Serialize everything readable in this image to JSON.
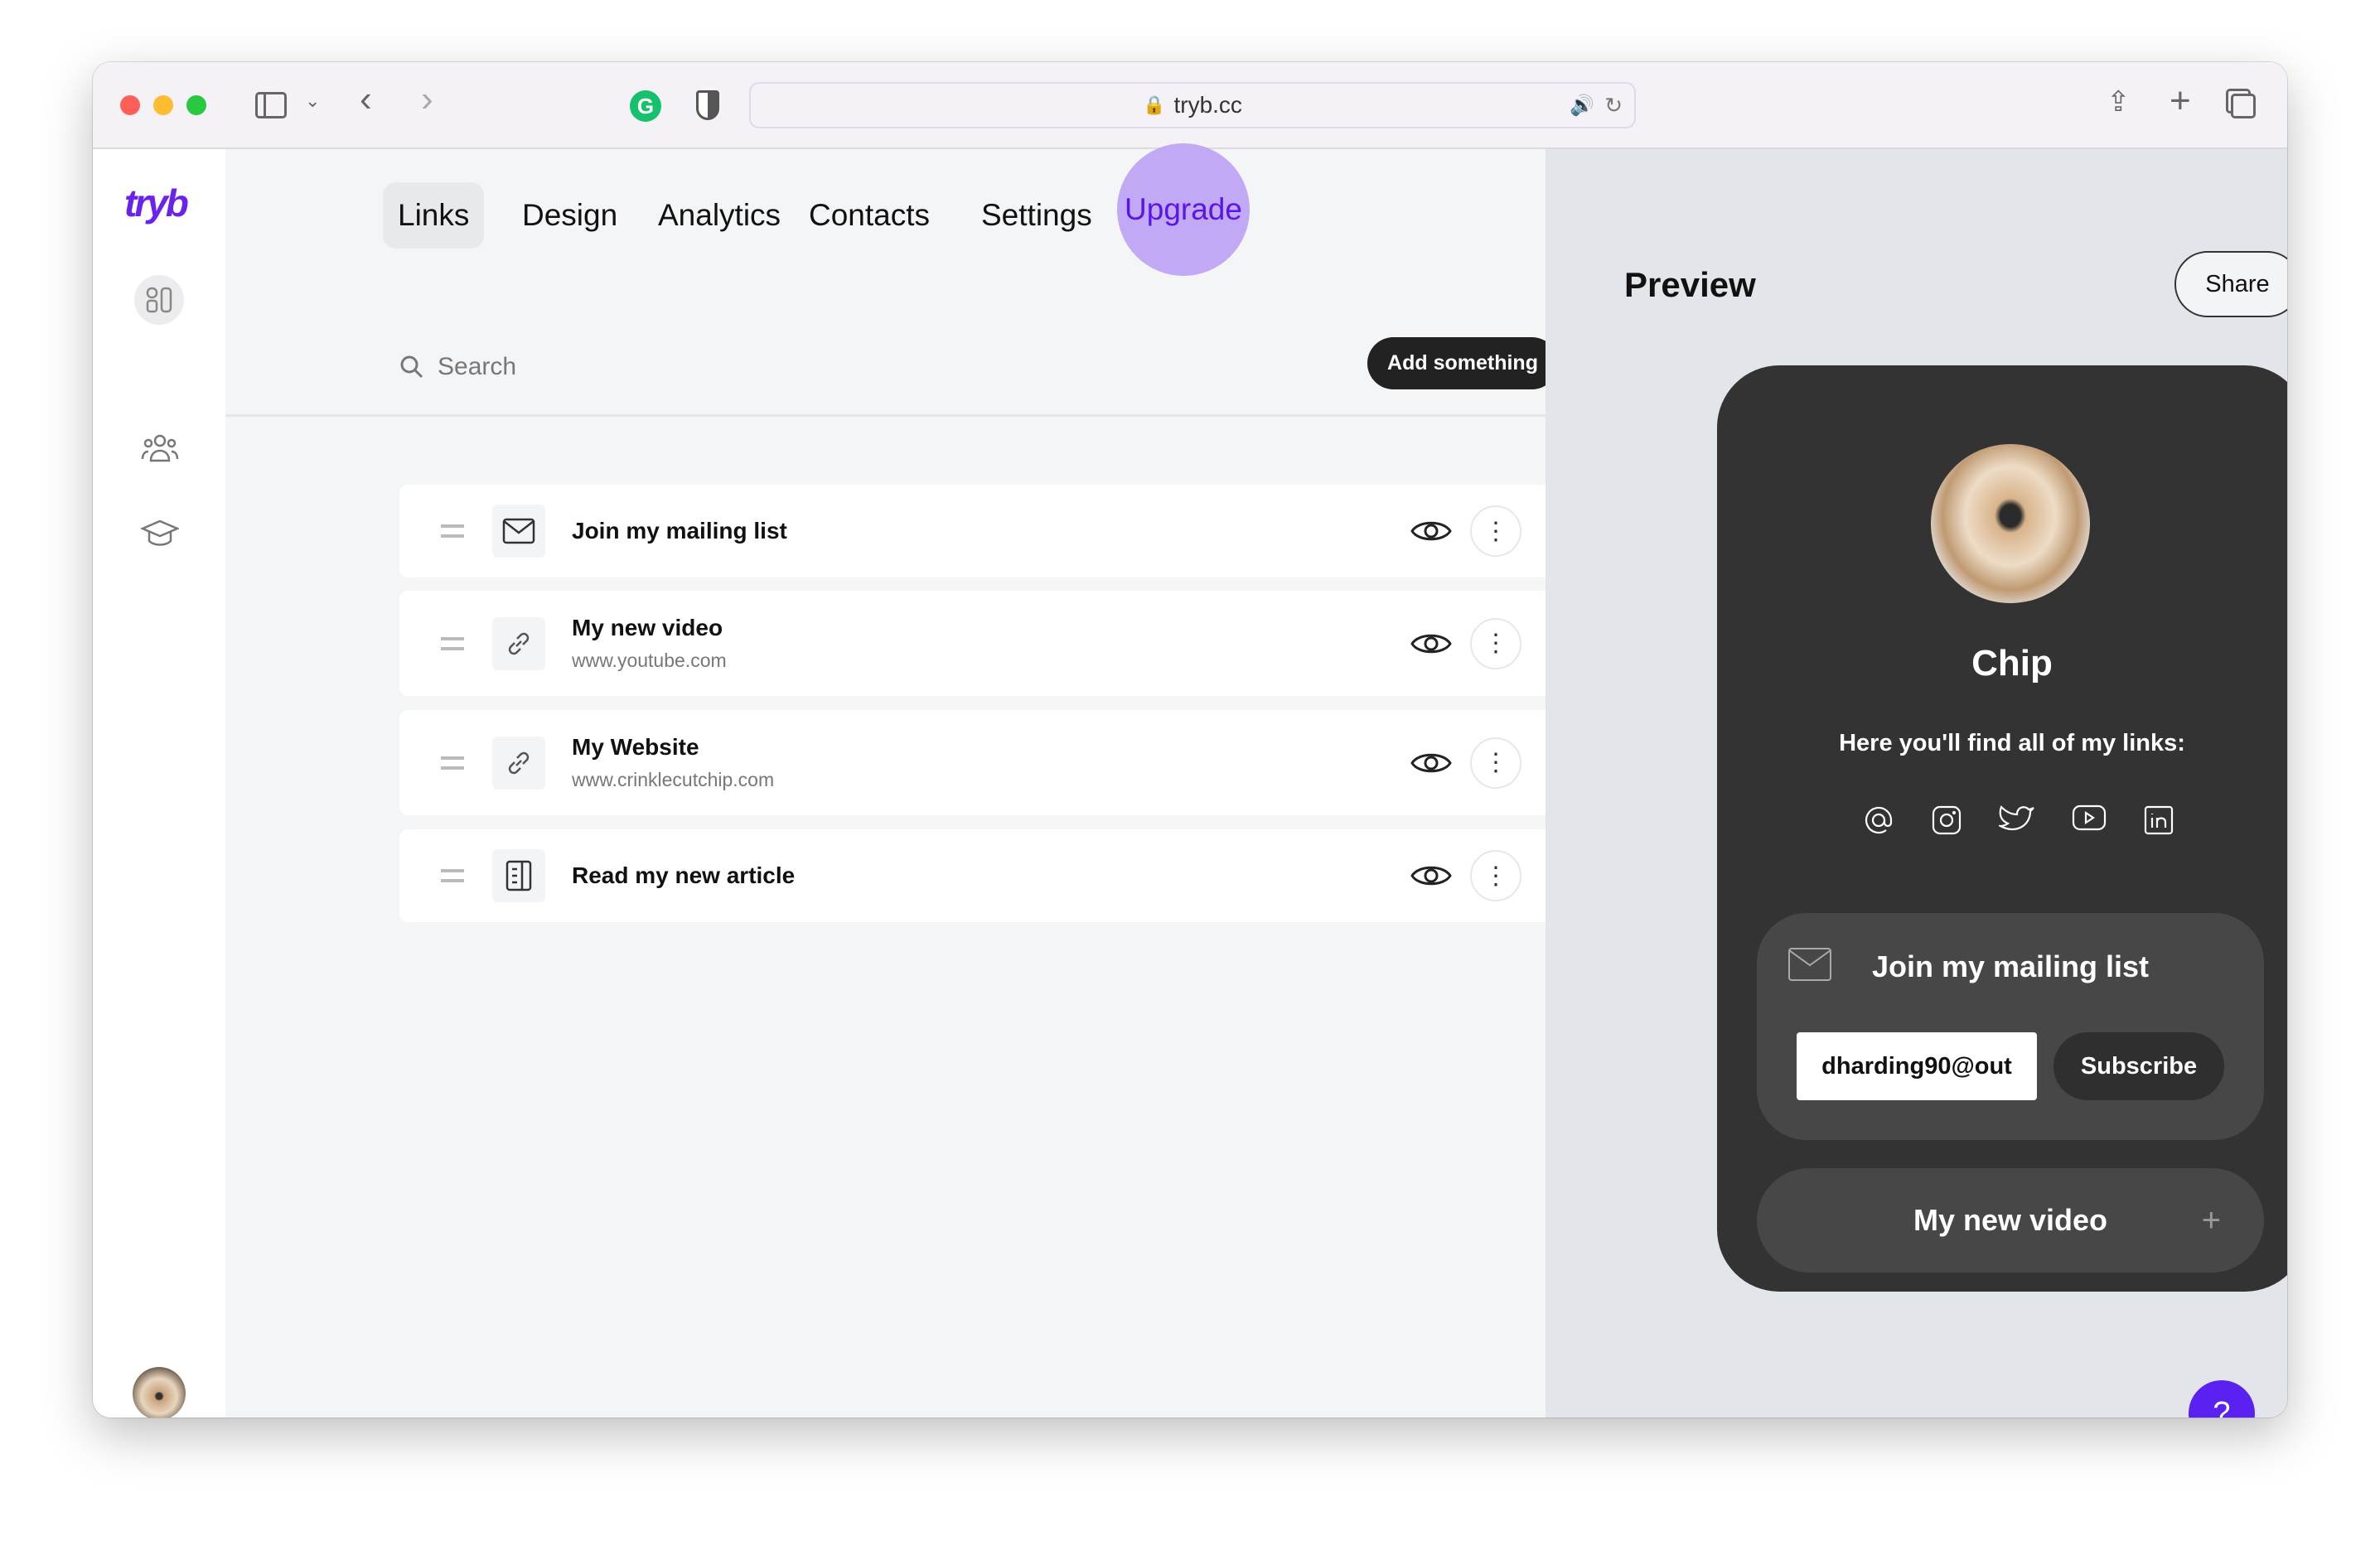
{
  "browser": {
    "url": "tryb.cc"
  },
  "sidebar": {
    "logo": "tryb",
    "icons": [
      "dashboard-icon",
      "users-icon",
      "graduation-cap-icon"
    ]
  },
  "tabs": [
    {
      "label": "Links",
      "active": true
    },
    {
      "label": "Design"
    },
    {
      "label": "Analytics"
    },
    {
      "label": "Contacts"
    },
    {
      "label": "Settings"
    },
    {
      "label": "Upgrade"
    }
  ],
  "search": {
    "placeholder": "Search"
  },
  "add_button": "Add something",
  "items": [
    {
      "title": "Join my mailing list",
      "subtitle": "",
      "icon": "mail-icon"
    },
    {
      "title": "My new video",
      "subtitle": "www.youtube.com",
      "icon": "link-icon"
    },
    {
      "title": "My Website",
      "subtitle": "www.crinklecutchip.com",
      "icon": "link-icon"
    },
    {
      "title": "Read my new article",
      "subtitle": "",
      "icon": "article-icon"
    }
  ],
  "preview": {
    "title": "Preview",
    "share": "Share",
    "name": "Chip",
    "tagline": "Here you'll find all of my links:",
    "socials": [
      "email-icon",
      "instagram-icon",
      "twitter-icon",
      "youtube-icon",
      "linkedin-icon"
    ],
    "mailing": {
      "title": "Join my mailing list",
      "email_value": "dharding90@out",
      "subscribe": "Subscribe"
    },
    "video": {
      "title": "My new video"
    }
  },
  "help": "?",
  "colors": {
    "accent": "#5a16e8",
    "upgrade_bg": "#c2a9f5",
    "phone_bg": "#333333"
  }
}
